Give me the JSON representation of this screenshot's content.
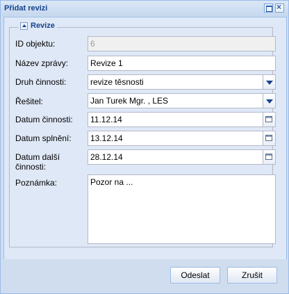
{
  "window": {
    "title": "Přidat revizi"
  },
  "fieldset": {
    "legend": "Revize"
  },
  "form": {
    "id": {
      "label": "ID objektu:",
      "value": "6"
    },
    "name": {
      "label": "Název zprávy:",
      "value": "Revize 1"
    },
    "activity_type": {
      "label": "Druh činnosti:",
      "value": "revize těsnosti"
    },
    "solver": {
      "label": "Řešitel:",
      "value": "Jan Turek Mgr. , LES"
    },
    "activity_date": {
      "label": "Datum činnosti:",
      "value": "11.12.14"
    },
    "done_date": {
      "label": "Datum splnění:",
      "value": "13.12.14"
    },
    "next_date": {
      "label_line1": "Datum další",
      "label_line2": "činnosti:",
      "value": "28.12.14"
    },
    "note": {
      "label": "Poznámka:",
      "value": "Pozor na ..."
    }
  },
  "buttons": {
    "submit": "Odeslat",
    "cancel": "Zrušit"
  },
  "icons": {
    "maximize": "maximize-icon",
    "close": "close-icon",
    "collapse": "collapse-icon",
    "dropdown": "chevron-down-icon",
    "calendar": "calendar-icon"
  },
  "colors": {
    "title": "#15428b",
    "border": "#99bbe8",
    "panel": "#dfe8f6"
  }
}
